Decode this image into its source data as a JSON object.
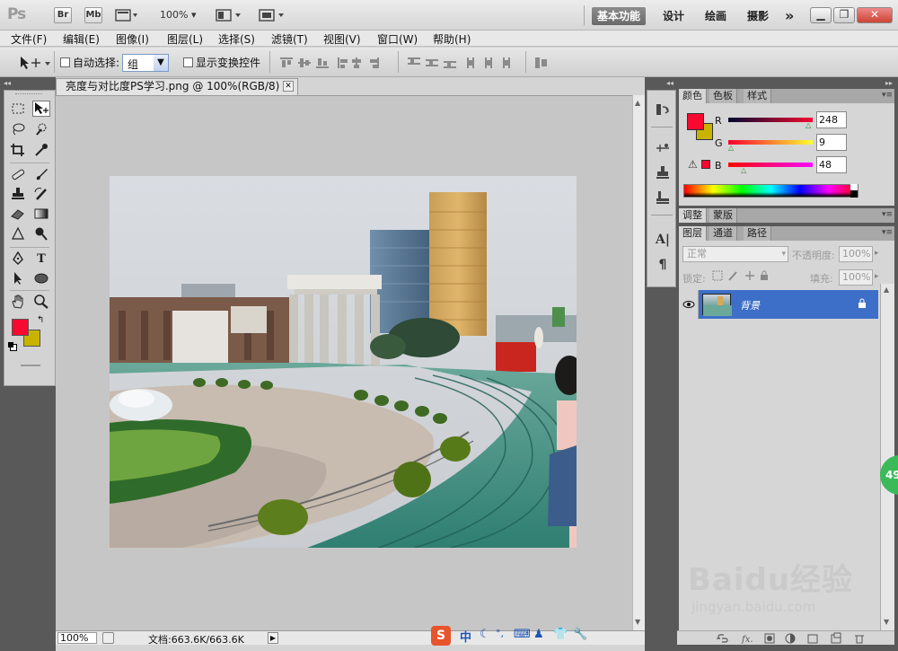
{
  "app": {
    "logo": "Ps",
    "bridge_btn": "Br",
    "minibridge_btn": "Mb",
    "zoom_dd": "100%",
    "workspaces": [
      "基本功能",
      "设计",
      "绘画",
      "摄影"
    ],
    "more_ws": "»",
    "accent": "#2c5fa8"
  },
  "menu": [
    "文件(F)",
    "编辑(E)",
    "图像(I)",
    "图层(L)",
    "选择(S)",
    "滤镜(T)",
    "视图(V)",
    "窗口(W)",
    "帮助(H)"
  ],
  "options": {
    "auto_select_label": "自动选择:",
    "auto_select_value": "组",
    "show_transform_label": "显示变换控件"
  },
  "document": {
    "tab_title": "亮度与对比度PS学习.png @ 100%(RGB/8)",
    "zoom": "100%",
    "doc_info": "文档:663.6K/663.6K"
  },
  "color_panel": {
    "tabs": [
      "颜色",
      "色板",
      "样式"
    ],
    "r_label": "R",
    "g_label": "G",
    "b_label": "B",
    "r": "248",
    "g": "9",
    "b": "48",
    "fg_color": "#f8092f",
    "bg_color": "#c8b400"
  },
  "adjust_panel": {
    "tabs": [
      "调整",
      "蒙版"
    ]
  },
  "layers_panel": {
    "tabs": [
      "图层",
      "通道",
      "路径"
    ],
    "blend_mode": "正常",
    "opacity_label": "不透明度:",
    "opacity_value": "100%",
    "lock_label": "锁定:",
    "fill_label": "填充:",
    "fill_value": "100%",
    "layer_name": "背景"
  },
  "ime": {
    "lang": "中"
  },
  "float_badge": "49",
  "watermark": {
    "brand": "Baidu经验",
    "url": "jingyan.baidu.com"
  }
}
